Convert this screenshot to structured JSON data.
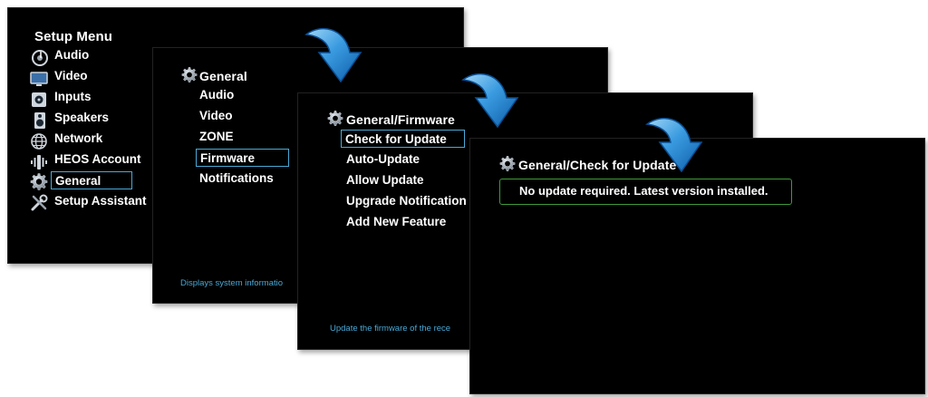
{
  "setup_menu": {
    "title": "Setup Menu",
    "items": [
      {
        "label": "Audio",
        "icon": "audio-icon"
      },
      {
        "label": "Video",
        "icon": "video-icon"
      },
      {
        "label": "Inputs",
        "icon": "inputs-icon"
      },
      {
        "label": "Speakers",
        "icon": "speakers-icon"
      },
      {
        "label": "Network",
        "icon": "network-icon"
      },
      {
        "label": "HEOS Account",
        "icon": "heos-account-icon"
      },
      {
        "label": "General",
        "icon": "gear-icon",
        "selected": true
      },
      {
        "label": "Setup Assistant",
        "icon": "tools-icon"
      }
    ]
  },
  "general_menu": {
    "title": "General",
    "items": [
      {
        "label": "Audio"
      },
      {
        "label": "Video"
      },
      {
        "label": "ZONE"
      },
      {
        "label": "Firmware",
        "selected": true
      },
      {
        "label": "Notifications"
      }
    ],
    "help": "Displays system informatio"
  },
  "firmware_menu": {
    "title": "General/Firmware",
    "items": [
      {
        "label": "Check for Update",
        "selected": true
      },
      {
        "label": "Auto-Update"
      },
      {
        "label": "Allow Update"
      },
      {
        "label": "Upgrade Notification"
      },
      {
        "label": "Add New Feature"
      }
    ],
    "help": "Update the firmware of the rece"
  },
  "check_update": {
    "title": "General/Check for Update",
    "message": "No update required. Latest version installed."
  },
  "colors": {
    "selection_border": "#4aa9d6",
    "message_border": "#3f9b3a",
    "help_text": "#4aa9d6",
    "arrow": "#2f8fd8"
  }
}
